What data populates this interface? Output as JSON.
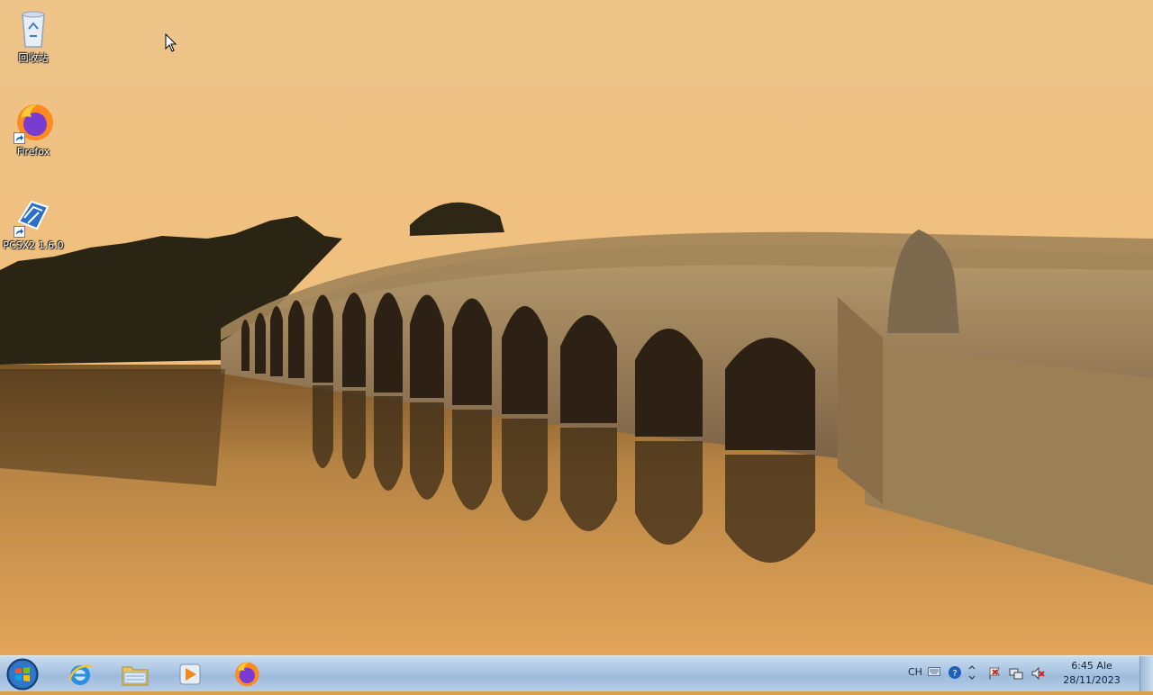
{
  "desktop": {
    "icons": [
      {
        "label": "回收站",
        "icon": "recycle-bin-icon"
      },
      {
        "label": "Firefox",
        "icon": "firefox-icon"
      },
      {
        "label": "PCSX2 1.6.0",
        "icon": "pcsx2-icon"
      }
    ]
  },
  "taskbar": {
    "start": "windows-start-orb",
    "pinned": [
      {
        "name": "Internet Explorer",
        "icon": "internet-explorer-icon"
      },
      {
        "name": "Windows Explorer",
        "icon": "folder-icon"
      },
      {
        "name": "Windows Media Player",
        "icon": "media-player-icon"
      },
      {
        "name": "Firefox",
        "icon": "firefox-icon"
      }
    ],
    "tray": {
      "language": "CH",
      "icons": [
        "keyboard-icon",
        "help-icon",
        "show-hidden-icons-icon",
        "action-center-flag-icon",
        "network-icon",
        "volume-muted-icon"
      ],
      "time": "6:45 Ale",
      "date": "28/11/2023"
    }
  }
}
